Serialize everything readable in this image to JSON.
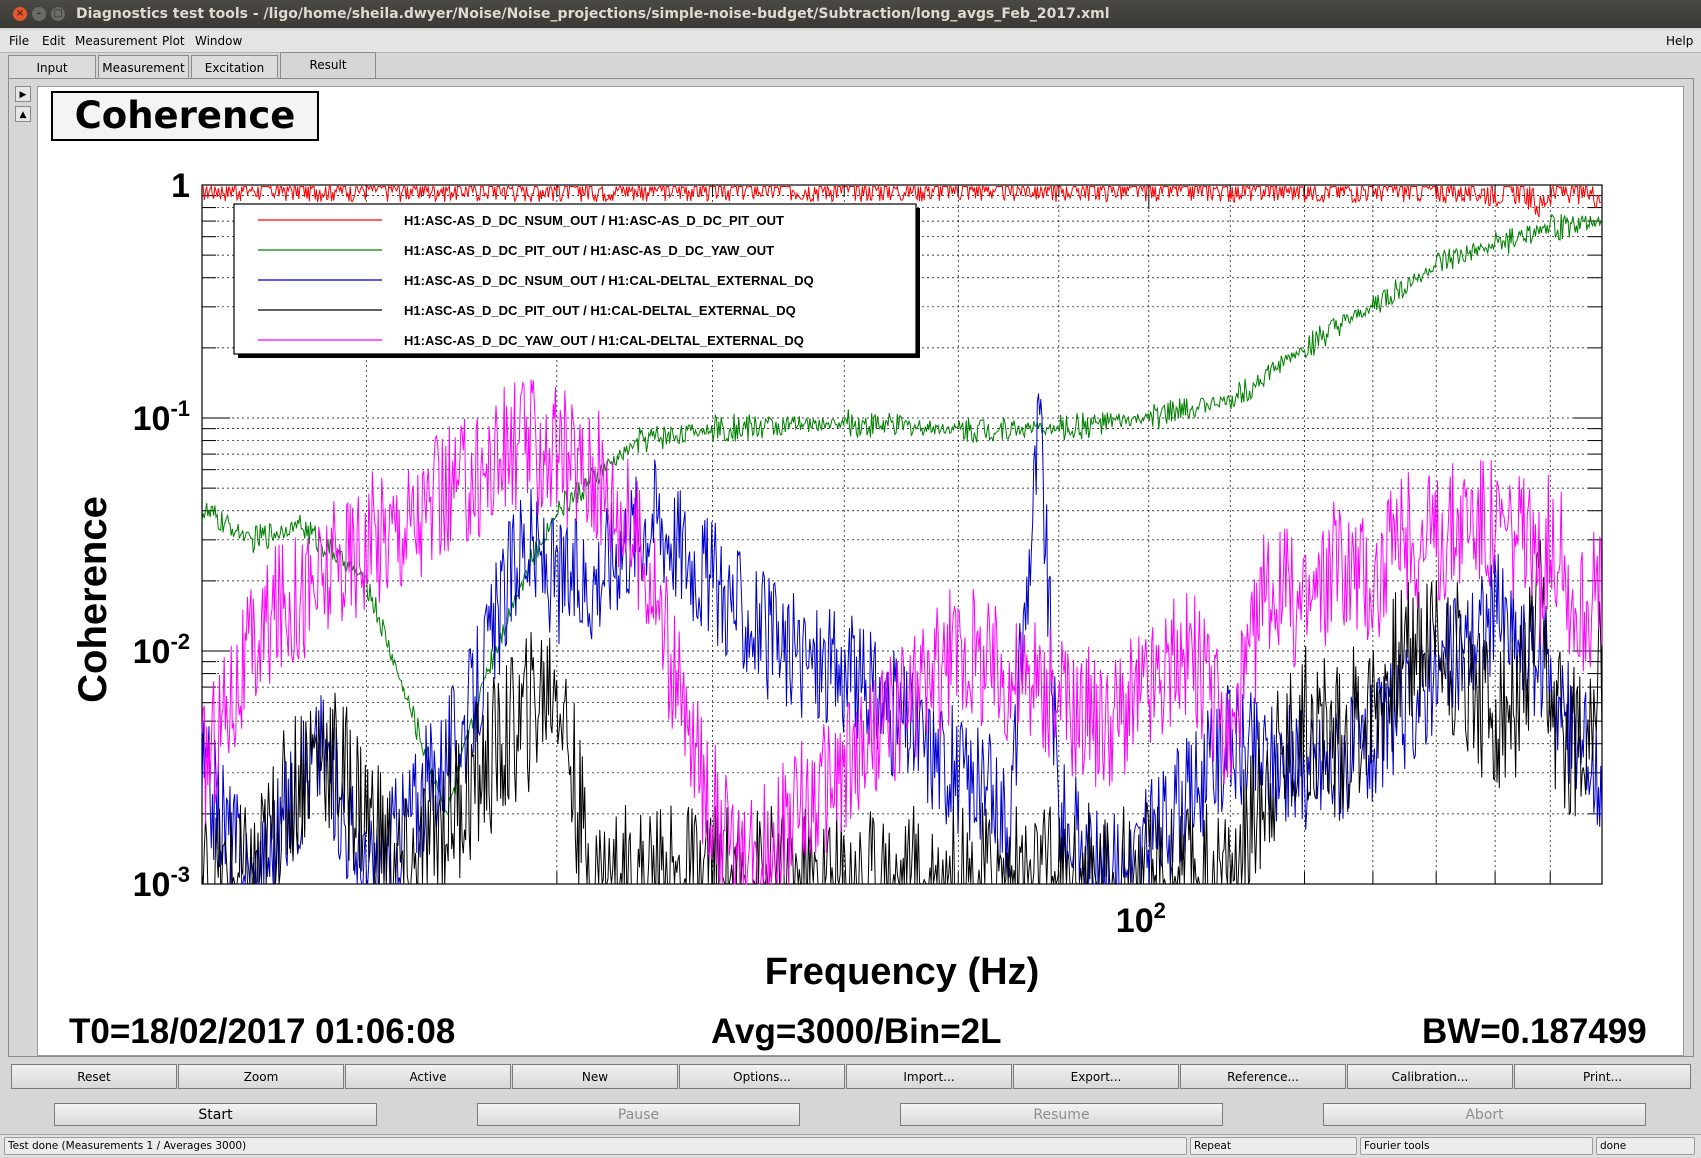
{
  "window": {
    "title": "Diagnostics test tools - /ligo/home/sheila.dwyer/Noise/Noise_projections/simple-noise-budget/Subtraction/long_avgs_Feb_2017.xml"
  },
  "menu": {
    "file": "File",
    "edit": "Edit",
    "measurement": "Measurement",
    "plot": "Plot",
    "window": "Window",
    "help": "Help"
  },
  "tabs": [
    {
      "label": "Input",
      "active": false
    },
    {
      "label": "Measurement",
      "active": false
    },
    {
      "label": "Excitation",
      "active": false
    },
    {
      "label": "Result",
      "active": true
    }
  ],
  "plot_title": "Coherence",
  "chart_data": {
    "type": "line",
    "x_scale": "log",
    "y_scale": "log",
    "xlim": [
      33,
      170
    ],
    "ylim": [
      0.001,
      1
    ],
    "xlabel": "Frequency (Hz)",
    "ylabel": "Coherence",
    "x_ticks": [
      {
        "value": 100,
        "base": "10",
        "exp": "2"
      }
    ],
    "y_ticks": [
      {
        "value": 1,
        "base": "1",
        "exp": ""
      },
      {
        "value": 0.1,
        "base": "10",
        "exp": "-1"
      },
      {
        "value": 0.01,
        "base": "10",
        "exp": "-2"
      },
      {
        "value": 0.001,
        "base": "10",
        "exp": "-3"
      }
    ],
    "grid": true,
    "legend_position": "top-left",
    "series": [
      {
        "name": "H1:ASC-AS_D_DC_NSUM_OUT / H1:ASC-AS_D_DC_PIT_OUT",
        "color": "#ff0000",
        "x": [
          33,
          60,
          100,
          140,
          150,
          155,
          158,
          160,
          162,
          165,
          170
        ],
        "y": [
          0.97,
          0.97,
          0.97,
          0.96,
          0.93,
          0.95,
          0.8,
          0.94,
          0.95,
          0.94,
          0.91
        ]
      },
      {
        "name": "H1:ASC-AS_D_DC_PIT_OUT / H1:ASC-AS_D_DC_YAW_OUT",
        "color": "#008000",
        "x": [
          33,
          35,
          37,
          40,
          42,
          44,
          46,
          48,
          50,
          55,
          60,
          70,
          80,
          90,
          100,
          110,
          120,
          130,
          140,
          150,
          160,
          170
        ],
        "y": [
          0.04,
          0.03,
          0.035,
          0.02,
          0.006,
          0.002,
          0.008,
          0.02,
          0.04,
          0.08,
          0.09,
          0.095,
          0.09,
          0.09,
          0.1,
          0.12,
          0.2,
          0.3,
          0.45,
          0.55,
          0.65,
          0.7
        ]
      },
      {
        "name": "H1:ASC-AS_D_DC_NSUM_OUT / H1:CAL-DELTAL_EXTERNAL_DQ",
        "color": "#0000cc",
        "x": [
          33,
          35,
          38,
          40,
          45,
          48,
          50,
          52,
          54,
          56,
          60,
          65,
          70,
          75,
          80,
          85,
          88,
          90,
          95,
          100,
          110,
          120,
          130,
          140,
          150,
          155,
          160,
          165,
          170
        ],
        "y": [
          0.003,
          0.001,
          0.004,
          0.001,
          0.005,
          0.03,
          0.02,
          0.02,
          0.03,
          0.04,
          0.02,
          0.01,
          0.008,
          0.005,
          0.003,
          0.002,
          0.1,
          0.002,
          0.001,
          0.0015,
          0.004,
          0.003,
          0.004,
          0.008,
          0.015,
          0.01,
          0.008,
          0.004,
          0.003
        ]
      },
      {
        "name": "H1:ASC-AS_D_DC_PIT_OUT / H1:CAL-DELTAL_EXTERNAL_DQ",
        "color": "#000000",
        "x": [
          33,
          35,
          37,
          38,
          40,
          42,
          44,
          48,
          50,
          52,
          55,
          60,
          70,
          80,
          90,
          100,
          110,
          115,
          120,
          125,
          130,
          135,
          140,
          145,
          150,
          155,
          158,
          160,
          165,
          170
        ],
        "y": [
          0.001,
          0.001,
          0.003,
          0.004,
          0.002,
          0.001,
          0.002,
          0.005,
          0.008,
          0.001,
          0.001,
          0.001,
          0.001,
          0.001,
          0.001,
          0.001,
          0.001,
          0.003,
          0.005,
          0.004,
          0.006,
          0.01,
          0.012,
          0.008,
          0.005,
          0.006,
          0.015,
          0.005,
          0.004,
          0.008
        ]
      },
      {
        "name": "H1:ASC-AS_D_DC_YAW_OUT / H1:CAL-DELTAL_EXTERNAL_DQ",
        "color": "#ff00ff",
        "x": [
          33,
          34,
          36,
          38,
          40,
          43,
          46,
          48,
          50,
          52,
          54,
          56,
          58,
          62,
          66,
          70,
          75,
          80,
          85,
          90,
          95,
          100,
          105,
          110,
          115,
          120,
          125,
          130,
          135,
          140,
          145,
          150,
          155,
          158,
          160,
          165,
          170
        ],
        "y": [
          0.003,
          0.006,
          0.015,
          0.02,
          0.03,
          0.04,
          0.06,
          0.08,
          0.07,
          0.06,
          0.04,
          0.02,
          0.005,
          0.001,
          0.002,
          0.003,
          0.006,
          0.01,
          0.008,
          0.006,
          0.005,
          0.007,
          0.01,
          0.004,
          0.02,
          0.015,
          0.025,
          0.02,
          0.03,
          0.03,
          0.04,
          0.035,
          0.03,
          0.02,
          0.035,
          0.015,
          0.018
        ]
      }
    ]
  },
  "info": {
    "t0": "T0=18/02/2017 01:06:08",
    "avg": "Avg=3000/Bin=2L",
    "bw": "BW=0.187499"
  },
  "buttons": [
    "Reset",
    "Zoom",
    "Active",
    "New",
    "Options...",
    "Import...",
    "Export...",
    "Reference...",
    "Calibration...",
    "Print..."
  ],
  "controls": {
    "start": "Start",
    "pause": "Pause",
    "resume": "Resume",
    "abort": "Abort"
  },
  "status": {
    "message": "Test done (Measurements 1 / Averages 3000)",
    "repeat": "Repeat",
    "fourier": "Fourier tools",
    "state": "done"
  }
}
